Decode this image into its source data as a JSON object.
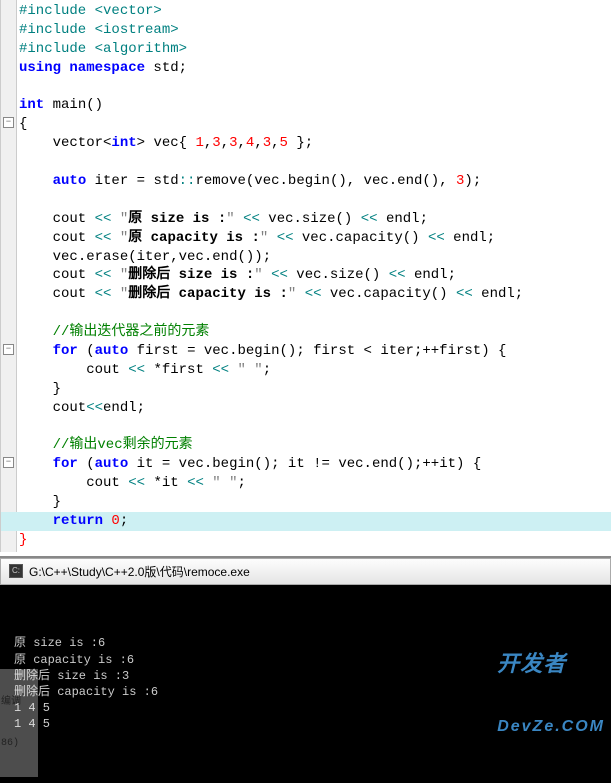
{
  "code": {
    "lines": [
      {
        "seg": [
          {
            "t": "#include <vector>",
            "c": "kw-teal"
          }
        ]
      },
      {
        "seg": [
          {
            "t": "#include <iostream>",
            "c": "kw-teal"
          }
        ]
      },
      {
        "seg": [
          {
            "t": "#include <algorithm>",
            "c": "kw-teal"
          }
        ]
      },
      {
        "seg": [
          {
            "t": "using namespace ",
            "c": "kw-blue"
          },
          {
            "t": "std",
            "c": "kw-black"
          },
          {
            "t": ";",
            "c": "kw-black"
          }
        ]
      },
      {
        "seg": [],
        "blank": true
      },
      {
        "seg": [
          {
            "t": "int ",
            "c": "kw-blue"
          },
          {
            "t": "main",
            "c": "kw-black"
          },
          {
            "t": "()",
            "c": "kw-black"
          }
        ]
      },
      {
        "seg": [
          {
            "t": "{",
            "c": "kw-black"
          }
        ],
        "fold": true
      },
      {
        "seg": [
          {
            "t": "    vector",
            "c": "kw-black"
          },
          {
            "t": "<",
            "c": "kw-black"
          },
          {
            "t": "int",
            "c": "kw-blue"
          },
          {
            "t": ">",
            "c": "kw-black"
          },
          {
            "t": " vec",
            "c": "kw-black"
          },
          {
            "t": "{",
            "c": "kw-black"
          },
          {
            "t": " ",
            "c": ""
          },
          {
            "t": "1",
            "c": "num-red"
          },
          {
            "t": ",",
            "c": "kw-black"
          },
          {
            "t": "3",
            "c": "num-red"
          },
          {
            "t": ",",
            "c": "kw-black"
          },
          {
            "t": "3",
            "c": "num-red"
          },
          {
            "t": ",",
            "c": "kw-black"
          },
          {
            "t": "4",
            "c": "num-red"
          },
          {
            "t": ",",
            "c": "kw-black"
          },
          {
            "t": "3",
            "c": "num-red"
          },
          {
            "t": ",",
            "c": "kw-black"
          },
          {
            "t": "5",
            "c": "num-red"
          },
          {
            "t": " }",
            "c": "kw-black"
          },
          {
            "t": ";",
            "c": "kw-black"
          }
        ]
      },
      {
        "seg": [],
        "blank": true
      },
      {
        "seg": [
          {
            "t": "    ",
            "c": ""
          },
          {
            "t": "auto ",
            "c": "kw-blue"
          },
          {
            "t": "iter ",
            "c": "kw-black"
          },
          {
            "t": "=",
            "c": "kw-black"
          },
          {
            "t": " std",
            "c": "kw-black"
          },
          {
            "t": "::",
            "c": "op-teal"
          },
          {
            "t": "remove",
            "c": "kw-black"
          },
          {
            "t": "(",
            "c": "kw-black"
          },
          {
            "t": "vec",
            "c": "kw-black"
          },
          {
            "t": ".",
            "c": "kw-black"
          },
          {
            "t": "begin",
            "c": "kw-black"
          },
          {
            "t": "()",
            "c": "kw-black"
          },
          {
            "t": ", vec",
            "c": "kw-black"
          },
          {
            "t": ".",
            "c": "kw-black"
          },
          {
            "t": "end",
            "c": "kw-black"
          },
          {
            "t": "()",
            "c": "kw-black"
          },
          {
            "t": ", ",
            "c": "kw-black"
          },
          {
            "t": "3",
            "c": "num-red"
          },
          {
            "t": ")",
            "c": "kw-black"
          },
          {
            "t": ";",
            "c": "kw-black"
          }
        ]
      },
      {
        "seg": [],
        "blank": true
      },
      {
        "seg": [
          {
            "t": "    cout ",
            "c": "kw-black"
          },
          {
            "t": "<<",
            "c": "op-teal"
          },
          {
            "t": " ",
            "c": ""
          },
          {
            "t": "\"",
            "c": "str-lit"
          },
          {
            "t": "原 size is :",
            "c": "str-bold"
          },
          {
            "t": "\"",
            "c": "str-lit"
          },
          {
            "t": " ",
            "c": ""
          },
          {
            "t": "<<",
            "c": "op-teal"
          },
          {
            "t": " vec",
            "c": "kw-black"
          },
          {
            "t": ".",
            "c": "kw-black"
          },
          {
            "t": "size",
            "c": "kw-black"
          },
          {
            "t": "()",
            "c": "kw-black"
          },
          {
            "t": " ",
            "c": ""
          },
          {
            "t": "<<",
            "c": "op-teal"
          },
          {
            "t": " endl",
            "c": "kw-black"
          },
          {
            "t": ";",
            "c": "kw-black"
          }
        ]
      },
      {
        "seg": [
          {
            "t": "    cout ",
            "c": "kw-black"
          },
          {
            "t": "<<",
            "c": "op-teal"
          },
          {
            "t": " ",
            "c": ""
          },
          {
            "t": "\"",
            "c": "str-lit"
          },
          {
            "t": "原 capacity is :",
            "c": "str-bold"
          },
          {
            "t": "\"",
            "c": "str-lit"
          },
          {
            "t": " ",
            "c": ""
          },
          {
            "t": "<<",
            "c": "op-teal"
          },
          {
            "t": " vec",
            "c": "kw-black"
          },
          {
            "t": ".",
            "c": "kw-black"
          },
          {
            "t": "capacity",
            "c": "kw-black"
          },
          {
            "t": "()",
            "c": "kw-black"
          },
          {
            "t": " ",
            "c": ""
          },
          {
            "t": "<<",
            "c": "op-teal"
          },
          {
            "t": " endl",
            "c": "kw-black"
          },
          {
            "t": ";",
            "c": "kw-black"
          }
        ]
      },
      {
        "seg": [
          {
            "t": "    vec",
            "c": "kw-black"
          },
          {
            "t": ".",
            "c": "kw-black"
          },
          {
            "t": "erase",
            "c": "kw-black"
          },
          {
            "t": "(",
            "c": "kw-black"
          },
          {
            "t": "iter",
            "c": "kw-black"
          },
          {
            "t": ",",
            "c": "kw-black"
          },
          {
            "t": "vec",
            "c": "kw-black"
          },
          {
            "t": ".",
            "c": "kw-black"
          },
          {
            "t": "end",
            "c": "kw-black"
          },
          {
            "t": "())",
            "c": "kw-black"
          },
          {
            "t": ";",
            "c": "kw-black"
          }
        ]
      },
      {
        "seg": [
          {
            "t": "    cout ",
            "c": "kw-black"
          },
          {
            "t": "<<",
            "c": "op-teal"
          },
          {
            "t": " ",
            "c": ""
          },
          {
            "t": "\"",
            "c": "str-lit"
          },
          {
            "t": "删除后 size is :",
            "c": "str-bold"
          },
          {
            "t": "\"",
            "c": "str-lit"
          },
          {
            "t": " ",
            "c": ""
          },
          {
            "t": "<<",
            "c": "op-teal"
          },
          {
            "t": " vec",
            "c": "kw-black"
          },
          {
            "t": ".",
            "c": "kw-black"
          },
          {
            "t": "size",
            "c": "kw-black"
          },
          {
            "t": "()",
            "c": "kw-black"
          },
          {
            "t": " ",
            "c": ""
          },
          {
            "t": "<<",
            "c": "op-teal"
          },
          {
            "t": " endl",
            "c": "kw-black"
          },
          {
            "t": ";",
            "c": "kw-black"
          }
        ]
      },
      {
        "seg": [
          {
            "t": "    cout ",
            "c": "kw-black"
          },
          {
            "t": "<<",
            "c": "op-teal"
          },
          {
            "t": " ",
            "c": ""
          },
          {
            "t": "\"",
            "c": "str-lit"
          },
          {
            "t": "删除后 capacity is :",
            "c": "str-bold"
          },
          {
            "t": "\"",
            "c": "str-lit"
          },
          {
            "t": " ",
            "c": ""
          },
          {
            "t": "<<",
            "c": "op-teal"
          },
          {
            "t": " vec",
            "c": "kw-black"
          },
          {
            "t": ".",
            "c": "kw-black"
          },
          {
            "t": "capacity",
            "c": "kw-black"
          },
          {
            "t": "()",
            "c": "kw-black"
          },
          {
            "t": " ",
            "c": ""
          },
          {
            "t": "<<",
            "c": "op-teal"
          },
          {
            "t": " endl",
            "c": "kw-black"
          },
          {
            "t": ";",
            "c": "kw-black"
          }
        ]
      },
      {
        "seg": [],
        "blank": true
      },
      {
        "seg": [
          {
            "t": "    //输出迭代器之前的元素",
            "c": "comment-green"
          }
        ]
      },
      {
        "seg": [
          {
            "t": "    ",
            "c": ""
          },
          {
            "t": "for ",
            "c": "kw-blue"
          },
          {
            "t": "(",
            "c": "kw-black"
          },
          {
            "t": "auto ",
            "c": "kw-blue"
          },
          {
            "t": "first ",
            "c": "kw-black"
          },
          {
            "t": "=",
            "c": "kw-black"
          },
          {
            "t": " vec",
            "c": "kw-black"
          },
          {
            "t": ".",
            "c": "kw-black"
          },
          {
            "t": "begin",
            "c": "kw-black"
          },
          {
            "t": "()",
            "c": "kw-black"
          },
          {
            "t": "; first ",
            "c": "kw-black"
          },
          {
            "t": "<",
            "c": "kw-black"
          },
          {
            "t": " iter",
            "c": "kw-black"
          },
          {
            "t": ";",
            "c": "kw-black"
          },
          {
            "t": "++",
            "c": "kw-black"
          },
          {
            "t": "first",
            "c": "kw-black"
          },
          {
            "t": ")",
            "c": "kw-black"
          },
          {
            "t": " {",
            "c": "kw-black"
          }
        ],
        "fold": true
      },
      {
        "seg": [
          {
            "t": "        cout ",
            "c": "kw-black"
          },
          {
            "t": "<<",
            "c": "op-teal"
          },
          {
            "t": " ",
            "c": ""
          },
          {
            "t": "*",
            "c": "kw-black"
          },
          {
            "t": "first ",
            "c": "kw-black"
          },
          {
            "t": "<<",
            "c": "op-teal"
          },
          {
            "t": " ",
            "c": ""
          },
          {
            "t": "\" \"",
            "c": "str-lit"
          },
          {
            "t": ";",
            "c": "kw-black"
          }
        ]
      },
      {
        "seg": [
          {
            "t": "    }",
            "c": "kw-black"
          }
        ]
      },
      {
        "seg": [
          {
            "t": "    cout",
            "c": "kw-black"
          },
          {
            "t": "<<",
            "c": "op-teal"
          },
          {
            "t": "endl",
            "c": "kw-black"
          },
          {
            "t": ";",
            "c": "kw-black"
          }
        ]
      },
      {
        "seg": [],
        "blank": true
      },
      {
        "seg": [
          {
            "t": "    //输出vec剩余的元素",
            "c": "comment-green"
          }
        ]
      },
      {
        "seg": [
          {
            "t": "    ",
            "c": ""
          },
          {
            "t": "for ",
            "c": "kw-blue"
          },
          {
            "t": "(",
            "c": "kw-black"
          },
          {
            "t": "auto ",
            "c": "kw-blue"
          },
          {
            "t": "it ",
            "c": "kw-black"
          },
          {
            "t": "=",
            "c": "kw-black"
          },
          {
            "t": " vec",
            "c": "kw-black"
          },
          {
            "t": ".",
            "c": "kw-black"
          },
          {
            "t": "begin",
            "c": "kw-black"
          },
          {
            "t": "()",
            "c": "kw-black"
          },
          {
            "t": "; it ",
            "c": "kw-black"
          },
          {
            "t": "!=",
            "c": "kw-black"
          },
          {
            "t": " vec",
            "c": "kw-black"
          },
          {
            "t": ".",
            "c": "kw-black"
          },
          {
            "t": "end",
            "c": "kw-black"
          },
          {
            "t": "()",
            "c": "kw-black"
          },
          {
            "t": ";",
            "c": "kw-black"
          },
          {
            "t": "++",
            "c": "kw-black"
          },
          {
            "t": "it",
            "c": "kw-black"
          },
          {
            "t": ")",
            "c": "kw-black"
          },
          {
            "t": " {",
            "c": "kw-black"
          }
        ],
        "fold": true
      },
      {
        "seg": [
          {
            "t": "        cout ",
            "c": "kw-black"
          },
          {
            "t": "<<",
            "c": "op-teal"
          },
          {
            "t": " ",
            "c": ""
          },
          {
            "t": "*",
            "c": "kw-black"
          },
          {
            "t": "it ",
            "c": "kw-black"
          },
          {
            "t": "<<",
            "c": "op-teal"
          },
          {
            "t": " ",
            "c": ""
          },
          {
            "t": "\" \"",
            "c": "str-lit"
          },
          {
            "t": ";",
            "c": "kw-black"
          }
        ]
      },
      {
        "seg": [
          {
            "t": "    }",
            "c": "kw-black"
          }
        ]
      },
      {
        "seg": [
          {
            "t": "    ",
            "c": ""
          },
          {
            "t": "return ",
            "c": "kw-blue"
          },
          {
            "t": "0",
            "c": "num-red"
          },
          {
            "t": ";",
            "c": "kw-black"
          }
        ],
        "hl": true
      },
      {
        "seg": [
          {
            "t": "}",
            "c": "paren-red"
          }
        ]
      }
    ]
  },
  "console": {
    "title": "G:\\C++\\Study\\C++2.0版\\代码\\remoce.exe",
    "lines": [
      "原 size is :6",
      "原 capacity is :6",
      "删除后 size is :3",
      "删除后 capacity is :6",
      "1 4 5",
      "1 4 5"
    ],
    "sideLabel1": "编调",
    "sideLabel2": "86)"
  },
  "watermark": {
    "main": "开发者",
    "sub": "DevZe.COM"
  }
}
